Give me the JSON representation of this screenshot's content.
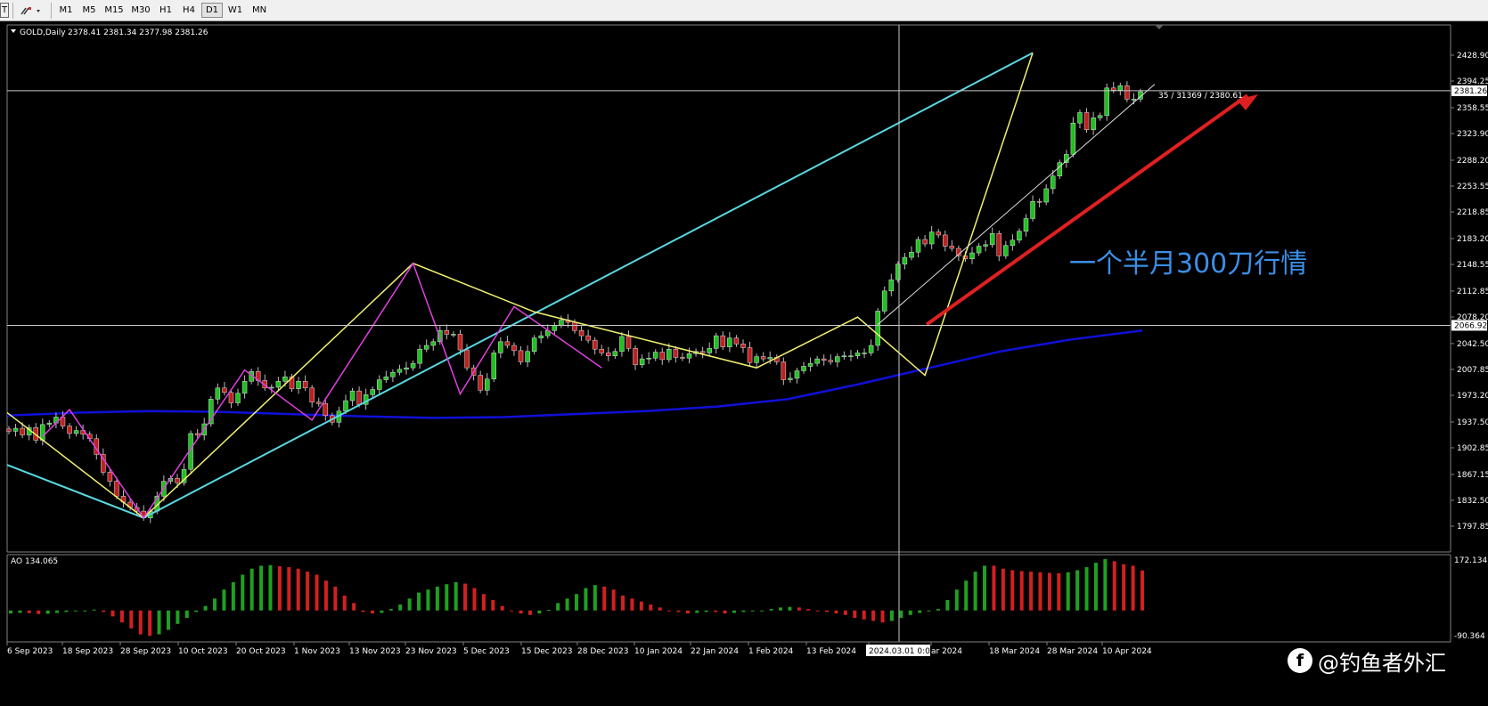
{
  "toolbar": {
    "timeframes": [
      "M1",
      "M5",
      "M15",
      "M30",
      "H1",
      "H4",
      "D1",
      "W1",
      "MN"
    ],
    "active": "D1"
  },
  "symbol": {
    "name": "GOLD,Daily",
    "ohlc": "2378.41 2381.34 2377.98 2381.26"
  },
  "chart_data": [
    {
      "type": "candlestick",
      "title": "GOLD,Daily 2378.41 2381.34 2377.98 2381.26",
      "ylim": [
        1797.85,
        2440
      ],
      "y_ticks": [
        "2428.90",
        "2394.25",
        "2358.55",
        "2323.90",
        "2288.20",
        "2253.55",
        "2218.85",
        "2183.20",
        "2148.55",
        "2112.85",
        "2078.20",
        "2042.50",
        "2007.85",
        "1973.20",
        "1937.50",
        "1902.85",
        "1867.15",
        "1832.50",
        "1797.85"
      ],
      "x_ticks": [
        "6 Sep 2023",
        "18 Sep 2023",
        "28 Sep 2023",
        "10 Oct 2023",
        "20 Oct 2023",
        "1 Nov 2023",
        "13 Nov 2023",
        "23 Nov 2023",
        "5 Dec 2023",
        "15 Dec 2023",
        "28 Dec 2023",
        "10 Jan 2024",
        "22 Jan 2024",
        "1 Feb 2024",
        "13 Feb 2024",
        "2024.03.01 0:00",
        "ar 2024",
        "18 Mar 2024",
        "28 Mar 2024",
        "10 Apr 2024"
      ],
      "price_labels": {
        "current": "2381.26",
        "crosshair": "2066.92"
      },
      "close_series": [
        1925,
        1929,
        1920,
        1930,
        1913,
        1934,
        1936,
        1944,
        1932,
        1922,
        1926,
        1921,
        1915,
        1894,
        1870,
        1858,
        1838,
        1830,
        1823,
        1818,
        1809,
        1818,
        1838,
        1858,
        1862,
        1856,
        1874,
        1922,
        1920,
        1935,
        1968,
        1983,
        1977,
        1963,
        1976,
        1992,
        2005,
        1993,
        1983,
        1984,
        1992,
        1998,
        1982,
        1992,
        1983,
        1964,
        1962,
        1946,
        1937,
        1952,
        1966,
        1979,
        1961,
        1974,
        1981,
        1994,
        1998,
        2004,
        2008,
        2010,
        2016,
        2035,
        2040,
        2045,
        2060,
        2055,
        2055,
        2034,
        2010,
        2000,
        1980,
        1995,
        2030,
        2045,
        2040,
        2033,
        2018,
        2032,
        2050,
        2053,
        2060,
        2067,
        2074,
        2071,
        2060,
        2053,
        2047,
        2035,
        2030,
        2026,
        2032,
        2052,
        2036,
        2014,
        2022,
        2023,
        2031,
        2021,
        2035,
        2024,
        2023,
        2029,
        2032,
        2030,
        2036,
        2053,
        2038,
        2050,
        2042,
        2037,
        2017,
        2025,
        2022,
        2024,
        2018,
        1994,
        1996,
        2006,
        2012,
        2016,
        2022,
        2020,
        2018,
        2025,
        2026,
        2026,
        2030,
        2030,
        2040,
        2086,
        2113,
        2128,
        2149,
        2158,
        2165,
        2182,
        2176,
        2192,
        2188,
        2173,
        2170,
        2160,
        2156,
        2164,
        2173,
        2175,
        2190,
        2160,
        2174,
        2181,
        2193,
        2210,
        2233,
        2232,
        2250,
        2267,
        2285,
        2296,
        2338,
        2352,
        2329,
        2345,
        2348,
        2385,
        2382,
        2388,
        2370,
        2370,
        2380
      ],
      "ma_series": [
        {
          "name": "",
          "color": "#1010d8",
          "values": [
            1946,
            1950,
            1952,
            1951,
            1948,
            1945,
            1943,
            1944,
            1948,
            1952,
            1958,
            1968,
            1988,
            2010,
            2032,
            2048,
            2060
          ]
        }
      ],
      "annotations": [
        "35 / 31369 / 2380.61"
      ],
      "caption": "一个半月300刀行情"
    },
    {
      "type": "bar",
      "title": "AO 134.065",
      "y_ticks": [
        "172.134",
        "-90.364"
      ],
      "ylim": [
        -90.364,
        172.134
      ],
      "values": [
        -10,
        -8,
        -9,
        -12,
        -11,
        -8,
        -5,
        -2,
        0,
        3,
        -5,
        -20,
        -40,
        -60,
        -80,
        -85,
        -80,
        -65,
        -45,
        -25,
        -5,
        15,
        40,
        70,
        95,
        120,
        140,
        150,
        152,
        148,
        145,
        140,
        130,
        120,
        100,
        80,
        50,
        25,
        -5,
        -10,
        -8,
        5,
        20,
        40,
        60,
        70,
        80,
        88,
        95,
        90,
        75,
        55,
        35,
        15,
        0,
        -10,
        -15,
        -10,
        2,
        25,
        40,
        55,
        75,
        85,
        80,
        70,
        50,
        40,
        30,
        20,
        10,
        0,
        -5,
        -10,
        -8,
        -5,
        -5,
        -10,
        -8,
        -5,
        -3,
        0,
        5,
        10,
        12,
        10,
        5,
        0,
        -5,
        -10,
        -15,
        -25,
        -30,
        -35,
        -40,
        -35,
        -25,
        -15,
        -8,
        0,
        5,
        35,
        70,
        100,
        130,
        150,
        150,
        140,
        135,
        132,
        130,
        128,
        126,
        125,
        128,
        135,
        145,
        160,
        172,
        165,
        155,
        150,
        134
      ],
      "colors": [
        "#d22020",
        "#20a020"
      ]
    }
  ],
  "watermark": {
    "logo": "f",
    "text": "@钓鱼者外汇"
  }
}
